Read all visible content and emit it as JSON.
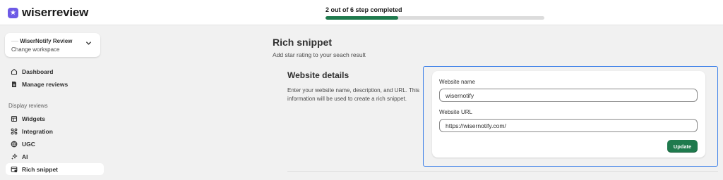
{
  "app": {
    "brand": "wiserreview"
  },
  "progress": {
    "label": "2 out of 6 step completed",
    "completed": 2,
    "total": 6,
    "fraction": 0.333
  },
  "workspace": {
    "name": "WiserNotify Review",
    "prefix": "-----",
    "action": "Change workspace"
  },
  "sidebar": {
    "items": [
      {
        "label": "Dashboard",
        "icon": "home-icon"
      },
      {
        "label": "Manage reviews",
        "icon": "document-icon"
      }
    ],
    "section_label": "Display reviews",
    "section_items": [
      {
        "label": "Widgets",
        "icon": "widgets-icon"
      },
      {
        "label": "Integration",
        "icon": "integration-icon"
      },
      {
        "label": "UGC",
        "icon": "ugc-icon"
      },
      {
        "label": "AI",
        "icon": "sparkle-icon"
      },
      {
        "label": "Rich snippet",
        "icon": "snippet-icon",
        "active": true
      }
    ]
  },
  "page": {
    "title": "Rich snippet",
    "subtitle": "Add star rating to your seach result"
  },
  "section": {
    "title": "Website details",
    "description": "Enter your website name, description, and URL. This information will be used to create a rich snippet."
  },
  "form": {
    "name_label": "Website name",
    "name_value": "wisernotify",
    "url_label": "Website URL",
    "url_value": "https://wisernotify.com/",
    "submit_label": "Update"
  },
  "colors": {
    "accent": "#1f7a4d",
    "brand": "#6d5ae6",
    "focus": "#3d80e8"
  }
}
